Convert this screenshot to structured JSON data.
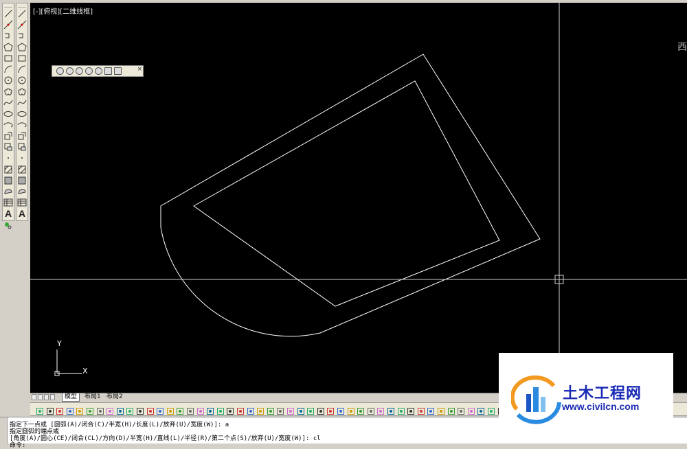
{
  "viewport": {
    "label": "[-][俯视][二维线框]"
  },
  "compass": {
    "text": "西"
  },
  "ucs": {
    "x_label": "X",
    "y_label": "Y"
  },
  "tabs": [
    {
      "label": "模型",
      "active": true
    },
    {
      "label": "布局1",
      "active": false
    },
    {
      "label": "布局2",
      "active": false
    }
  ],
  "left_toolbar_tools": [
    "line-icon",
    "construction-line-icon",
    "polyline-icon",
    "polygon-icon",
    "rectangle-icon",
    "arc-icon",
    "circle-icon",
    "revision-cloud-icon",
    "spline-icon",
    "ellipse-icon",
    "ellipse-arc-icon",
    "insert-block-icon",
    "make-block-icon",
    "point-icon",
    "hatch-icon",
    "gradient-icon",
    "region-icon",
    "table-icon",
    "multiline-text-icon",
    "add-selected-icon"
  ],
  "command": {
    "lines": [
      "指定下一点或 [圆弧(A)/闭合(C)/半宽(H)/长度(L)/放弃(U)/宽度(W)]: a",
      "指定圆弧的端点或",
      "[角度(A)/圆心(CE)/闭合(CL)/方向(D)/半宽(H)/直线(L)/半径(R)/第二个点(S)/放弃(U)/宽度(W)]: cl",
      "命令:"
    ]
  },
  "watermark": {
    "title": "土木工程网",
    "url": "www.civilcn.com"
  },
  "colors": {
    "canvas": "#000000",
    "geometry": "#ffffff",
    "watermark_blue": "#1a2bb5"
  }
}
